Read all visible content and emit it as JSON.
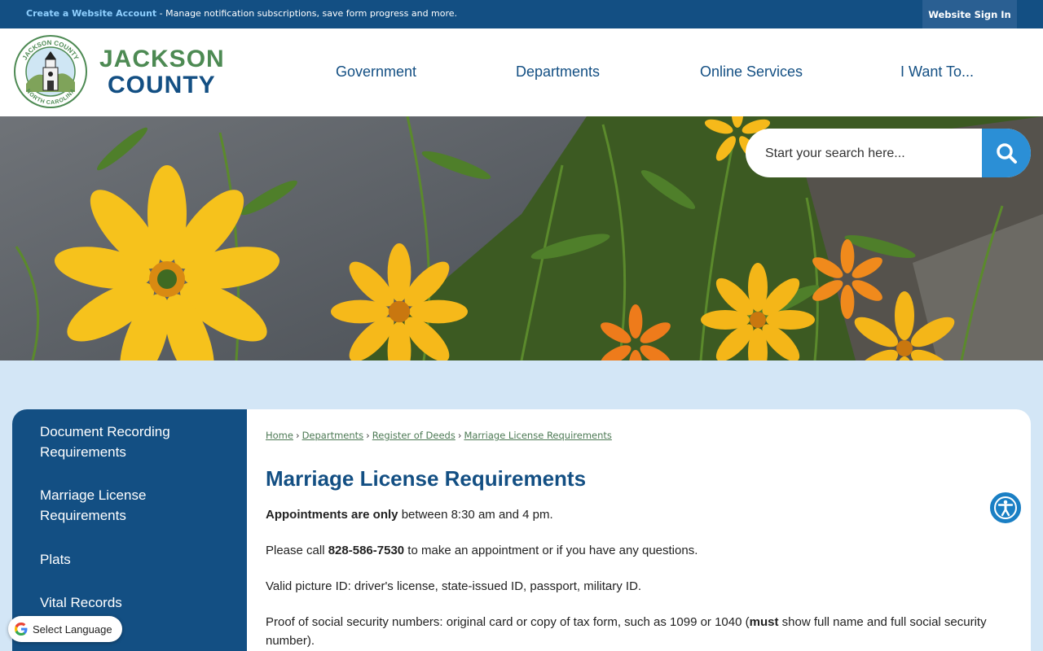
{
  "topbar": {
    "create_account_link": "Create a Website Account",
    "create_account_desc": " - Manage notification subscriptions, save form progress and more.",
    "signin_label": "Website Sign In"
  },
  "header": {
    "brand_line1": "JACKSON",
    "brand_line2": "COUNTY",
    "seal_text_top": "JACKSON COUNTY",
    "seal_text_bottom": "NORTH CAROLINA",
    "nav": [
      "Government",
      "Departments",
      "Online Services",
      "I Want To..."
    ]
  },
  "search": {
    "placeholder": "Start your search here...",
    "icon": "search-icon"
  },
  "sidebar": {
    "items": [
      {
        "label": "Document Recording Requirements"
      },
      {
        "label": "Marriage License Requirements"
      },
      {
        "label": "Plats"
      },
      {
        "label": "Vital Records"
      }
    ]
  },
  "breadcrumb": [
    "Home",
    "Departments",
    "Register of Deeds",
    "Marriage License Requirements"
  ],
  "breadcrumb_separator": "›",
  "page": {
    "title": "Marriage License Requirements",
    "p1_bold": "Appointments are only",
    "p1_rest": " between 8:30 am and 4 pm.",
    "p2_pre": "Please call ",
    "p2_phone": "828-586-7530",
    "p2_post": " to make an appointment or if you have any questions.",
    "p3": "Valid picture ID: driver's license, state-issued ID, passport, military ID.",
    "p4_pre": "Proof of social security numbers: original card or copy of tax form, such as 1099 or 1040 (",
    "p4_bold": "must",
    "p4_post": " show full name and full social security number)."
  },
  "widgets": {
    "accessibility_icon": "accessibility-icon",
    "translate_label": "Select Language"
  },
  "colors": {
    "primary": "#134f83",
    "accent": "#2b8fd6",
    "green": "#4d8a53",
    "page_bg": "#d3e6f6"
  }
}
